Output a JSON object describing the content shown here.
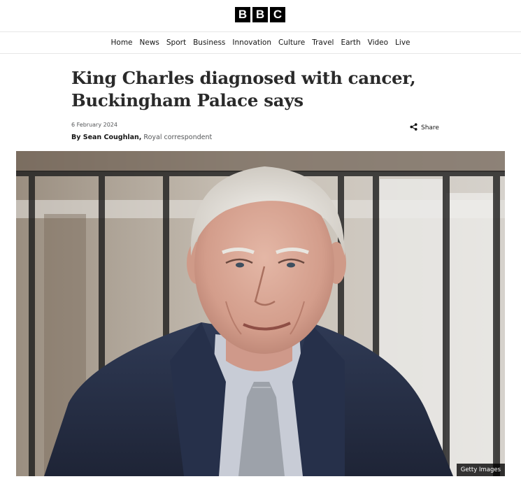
{
  "logo": {
    "letters": [
      "B",
      "B",
      "C"
    ]
  },
  "nav": {
    "items": [
      {
        "label": "Home"
      },
      {
        "label": "News"
      },
      {
        "label": "Sport"
      },
      {
        "label": "Business"
      },
      {
        "label": "Innovation"
      },
      {
        "label": "Culture"
      },
      {
        "label": "Travel"
      },
      {
        "label": "Earth"
      },
      {
        "label": "Video"
      },
      {
        "label": "Live"
      }
    ]
  },
  "article": {
    "headline_line1": "King Charles diagnosed with cancer,",
    "headline_line2": "Buckingham Palace says",
    "date": "6 February 2024",
    "byline_prefix": "By Sean Coughlan,",
    "byline_role": "Royal correspondent",
    "share_label": "Share",
    "image_credit": "Getty Images"
  },
  "colors": {
    "brand": "#000000",
    "text": "#141414",
    "muted": "#545658"
  },
  "icons": {
    "share": "share-icon"
  }
}
